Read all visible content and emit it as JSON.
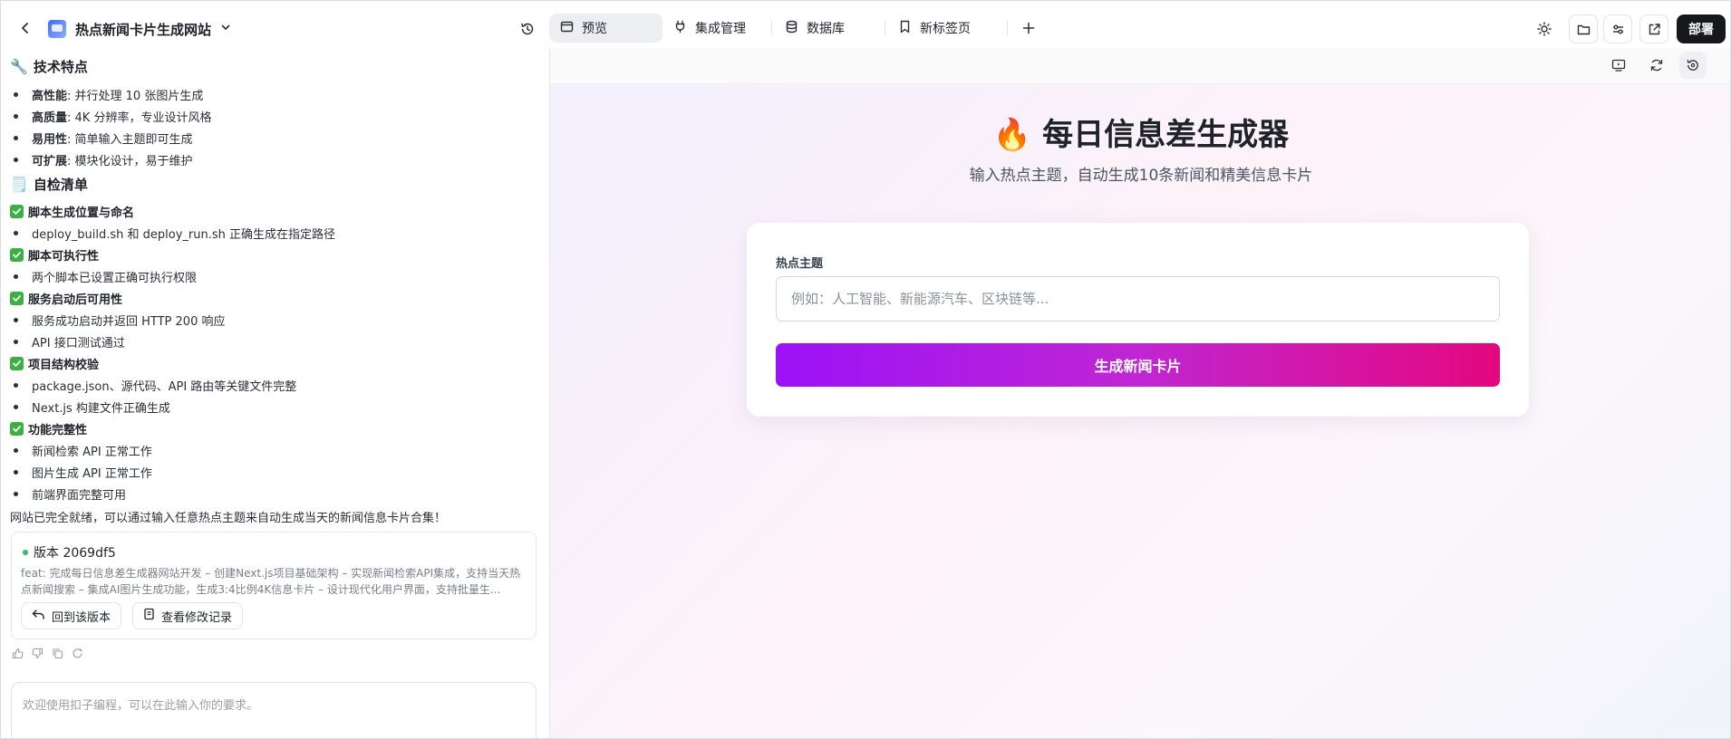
{
  "header": {
    "project_title": "热点新闻卡片生成网站",
    "tabs": [
      {
        "label": "预览",
        "icon": "browser-window-icon",
        "active": true
      },
      {
        "label": "集成管理",
        "icon": "plug-icon"
      },
      {
        "label": "数据库",
        "icon": "database-icon"
      },
      {
        "label": "新标签页",
        "icon": "bookmark-icon"
      }
    ],
    "deploy_label": "部署"
  },
  "chat": {
    "tech_heading": "技术特点",
    "tech_emoji": "🔧",
    "tech_items": [
      {
        "label": "高性能",
        "text": ": 并行处理 10 张图片生成"
      },
      {
        "label": "高质量",
        "text": ": 4K 分辨率，专业设计风格"
      },
      {
        "label": "易用性",
        "text": ": 简单输入主题即可生成"
      },
      {
        "label": "可扩展",
        "text": ": 模块化设计，易于维护"
      }
    ],
    "checklist_heading": "自检清单",
    "checklist_emoji": "🗒️",
    "checks": [
      {
        "title": "脚本生成位置与命名",
        "items": [
          "deploy_build.sh 和 deploy_run.sh 正确生成在指定路径"
        ]
      },
      {
        "title": "脚本可执行性",
        "items": [
          "两个脚本已设置正确可执行权限"
        ]
      },
      {
        "title": "服务启动后可用性",
        "items": [
          "服务成功启动并返回 HTTP 200 响应",
          "API 接口测试通过"
        ]
      },
      {
        "title": "项目结构校验",
        "items": [
          "package.json、源代码、API 路由等关键文件完整",
          "Next.js 构建文件正确生成"
        ]
      },
      {
        "title": "功能完整性",
        "items": [
          "新闻检索 API 正常工作",
          "图片生成 API 正常工作",
          "前端界面完整可用"
        ]
      }
    ],
    "summary": "网站已完全就绪，可以通过输入任意热点主题来自动生成当天的新闻信息卡片合集！",
    "version": {
      "title": "版本 2069df5",
      "description": "feat: 完成每日信息差生成器网站开发 – 创建Next.js项目基础架构 – 实现新闻检索API集成，支持当天热点新闻搜索 – 集成AI图片生成功能，生成3:4比例4K信息卡片 – 设计现代化用户界面，支持批量生...",
      "rollback_label": "回到该版本",
      "changes_label": "查看修改记录"
    },
    "input_placeholder": "欢迎使用扣子编程，可以在此输入你的要求。"
  },
  "preview": {
    "title_emoji": "🔥",
    "title": "每日信息差生成器",
    "subtitle": "输入热点主题，自动生成10条新闻和精美信息卡片",
    "field_label": "热点主题",
    "field_placeholder": "例如：人工智能、新能源汽车、区块链等...",
    "field_value": "",
    "generate_label": "生成新闻卡片"
  },
  "colors": {
    "deploy_bg": "#16181c",
    "check_green": "#3cb043",
    "gradient_start": "#9b12f7",
    "gradient_end": "#e4087f",
    "version_dot": "#22c55e"
  }
}
